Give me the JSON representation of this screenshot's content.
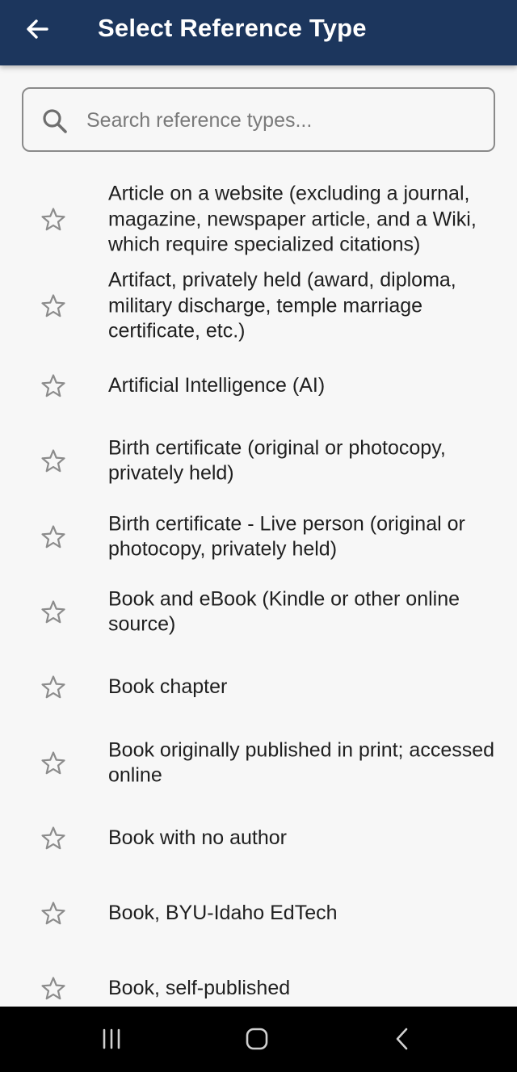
{
  "header": {
    "title": "Select Reference Type",
    "back_icon": "arrow-left-icon",
    "background": "#1c365d"
  },
  "search": {
    "placeholder": "Search reference types...",
    "value": "",
    "icon": "search-icon"
  },
  "items": [
    {
      "label": "Article on a website (excluding a journal, magazine, newspaper article, and a Wiki, which require specialized citations)",
      "favorite": false
    },
    {
      "label": "Artifact, privately held (award, diploma, military discharge, temple marriage certificate, etc.)",
      "favorite": false
    },
    {
      "label": "Artificial Intelligence (AI)",
      "favorite": false
    },
    {
      "label": "Birth certificate (original or photocopy, privately held)",
      "favorite": false
    },
    {
      "label": "Birth certificate - Live person (original or photocopy, privately held)",
      "favorite": false
    },
    {
      "label": "Book and eBook (Kindle or other online source)",
      "favorite": false
    },
    {
      "label": "Book chapter",
      "favorite": false
    },
    {
      "label": "Book originally published in print; accessed online",
      "favorite": false
    },
    {
      "label": "Book with no author",
      "favorite": false
    },
    {
      "label": "Book, BYU-Idaho EdTech",
      "favorite": false
    },
    {
      "label": "Book, self-published",
      "favorite": false
    }
  ],
  "system_nav": {
    "recents_icon": "recents-icon",
    "home_icon": "home-icon",
    "back_icon": "back-chevron-icon"
  }
}
